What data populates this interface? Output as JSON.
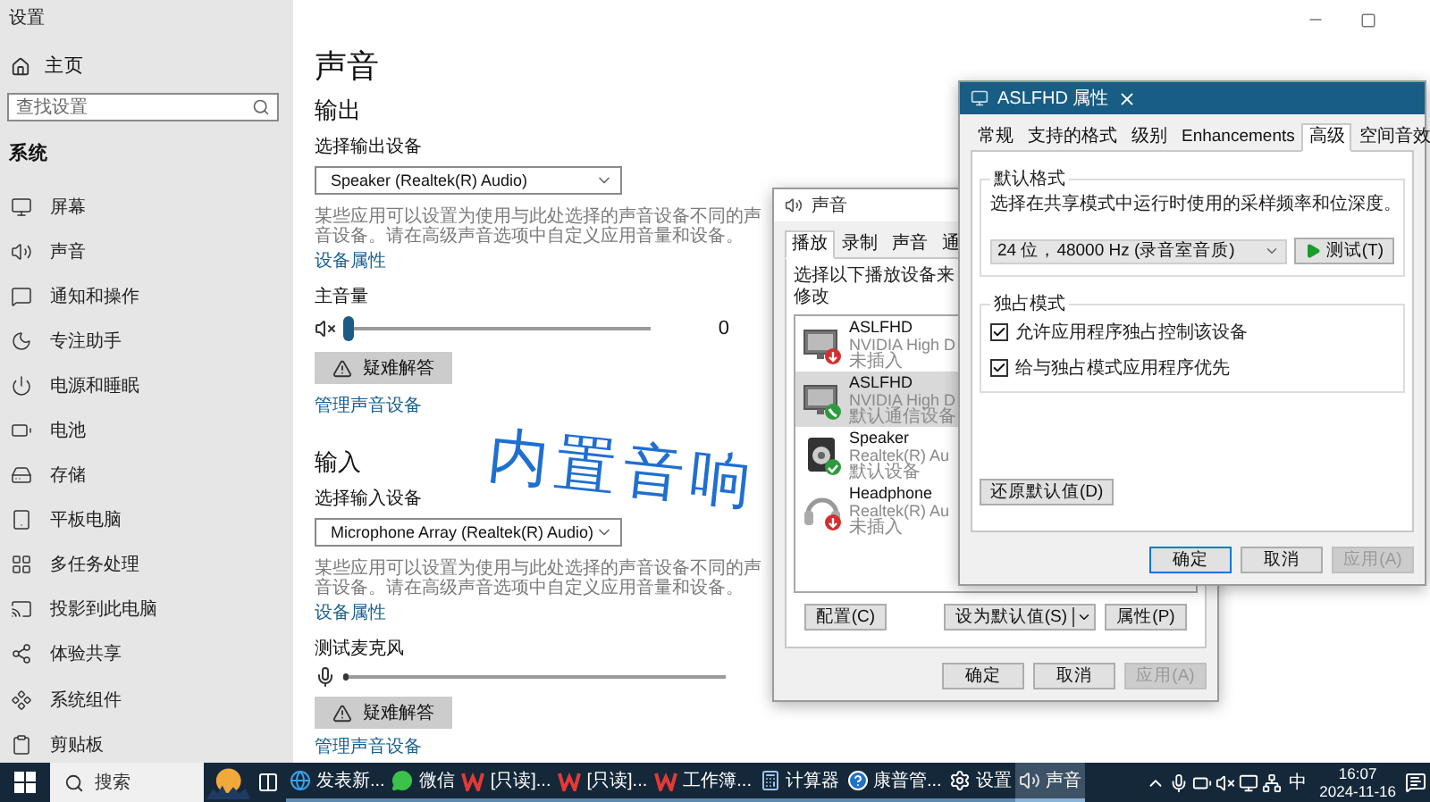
{
  "settings_window": {
    "title": "设置",
    "sidebar": {
      "home": "主页",
      "search": {
        "placeholder": "查找设置"
      },
      "section": "系统",
      "items": [
        {
          "label": "屏幕"
        },
        {
          "label": "声音"
        },
        {
          "label": "通知和操作"
        },
        {
          "label": "专注助手"
        },
        {
          "label": "电源和睡眠"
        },
        {
          "label": "电池"
        },
        {
          "label": "存储"
        },
        {
          "label": "平板电脑"
        },
        {
          "label": "多任务处理"
        },
        {
          "label": "投影到此电脑"
        },
        {
          "label": "体验共享"
        },
        {
          "label": "系统组件"
        },
        {
          "label": "剪贴板"
        }
      ]
    },
    "page": {
      "title": "声音",
      "output": {
        "heading": "输出",
        "device_label": "选择输出设备",
        "device": "Speaker (Realtek(R) Audio)",
        "note": "某些应用可以设置为使用与此处选择的声音设备不同的声音设备。请在高级声音选项中自定义应用音量和设备。",
        "properties_link": "设备属性",
        "volume_label": "主音量",
        "volume": {
          "muted": true,
          "level": 0,
          "reading": "0"
        },
        "troubleshoot": "疑难解答",
        "manage_link": "管理声音设备"
      },
      "input": {
        "heading": "输入",
        "device_label": "选择输入设备",
        "device": "Microphone Array (Realtek(R) Audio)",
        "note": "某些应用可以设置为使用与此处选择的声音设备不同的声音设备。请在高级声音选项中自定义应用音量和设备。",
        "properties_link": "设备属性",
        "test_label": "测试麦克风",
        "meter": {
          "level": 0
        },
        "troubleshoot": "疑难解答",
        "manage_link": "管理声音设备"
      }
    }
  },
  "sound_dialog": {
    "title": "声音",
    "tabs": [
      {
        "label": "播放",
        "selected": true
      },
      {
        "label": "录制",
        "selected": false
      },
      {
        "label": "声音",
        "selected": false
      },
      {
        "label": "通",
        "selected": false
      }
    ],
    "instruction": "选择以下播放设备来修改",
    "devices": [
      {
        "name": "ASLFHD",
        "driver": "NVIDIA High D",
        "status": "未插入",
        "kind": "monitor",
        "unplugged": true,
        "default_device": false,
        "default_communication": false,
        "selected": false
      },
      {
        "name": "ASLFHD",
        "driver": "NVIDIA High D",
        "status": "默认通信设备",
        "kind": "monitor",
        "unplugged": false,
        "default_device": false,
        "default_communication": true,
        "selected": true
      },
      {
        "name": "Speaker",
        "driver": "Realtek(R) Au",
        "status": "默认设备",
        "kind": "speaker",
        "unplugged": false,
        "default_device": true,
        "default_communication": false,
        "selected": false
      },
      {
        "name": "Headphone",
        "driver": "Realtek(R) Au",
        "status": "未插入",
        "kind": "headphone",
        "unplugged": true,
        "default_device": false,
        "default_communication": false,
        "selected": false
      }
    ],
    "configure": "配置(C)",
    "set_default": "设为默认值(S)",
    "properties": "属性(P)",
    "footer": [
      {
        "label": "确定",
        "disabled": false
      },
      {
        "label": "取消",
        "disabled": false
      },
      {
        "label": "应用(A)",
        "disabled": true
      }
    ]
  },
  "properties_dialog": {
    "title": "ASLFHD 属性",
    "tabs": [
      {
        "label": "常规",
        "selected": false
      },
      {
        "label": "支持的格式",
        "selected": false
      },
      {
        "label": "级别",
        "selected": false
      },
      {
        "label": "Enhancements",
        "selected": false
      },
      {
        "label": "高级",
        "selected": true
      },
      {
        "label": "空间音效",
        "selected": false
      }
    ],
    "default_format": {
      "legend": "默认格式",
      "description": "选择在共享模式中运行时使用的采样频率和位深度。",
      "format": "24 位，48000 Hz (录音室音质)",
      "test": "测试(T)"
    },
    "exclusive": {
      "legend": "独占模式",
      "options": [
        {
          "label": "允许应用程序独占控制该设备",
          "checked": true
        },
        {
          "label": "给与独占模式应用程序优先",
          "checked": true
        }
      ]
    },
    "restore": "还原默认值(D)",
    "footer": [
      {
        "label": "确定",
        "disabled": false,
        "focused": true
      },
      {
        "label": "取消",
        "disabled": false,
        "focused": false
      },
      {
        "label": "应用(A)",
        "disabled": true,
        "focused": false
      }
    ]
  },
  "annotation": "内置音响",
  "taskbar": {
    "search": "搜索",
    "apps": [
      {
        "label": "发表新...",
        "kind": "browser",
        "active": false
      },
      {
        "label": "微信",
        "kind": "chat",
        "active": false
      },
      {
        "label": "[只读]...",
        "kind": "wps",
        "active": false
      },
      {
        "label": "[只读]...",
        "kind": "wps",
        "active": false
      },
      {
        "label": "工作簿...",
        "kind": "wps",
        "active": false
      },
      {
        "label": "计算器",
        "kind": "calculator",
        "active": false
      },
      {
        "label": "康普管...",
        "kind": "help",
        "active": false
      },
      {
        "label": "设置",
        "kind": "settings",
        "active": false
      },
      {
        "label": "声音",
        "kind": "sound",
        "active": true
      }
    ],
    "ime": "中",
    "time": "16:07",
    "date": "2024-11-16"
  }
}
